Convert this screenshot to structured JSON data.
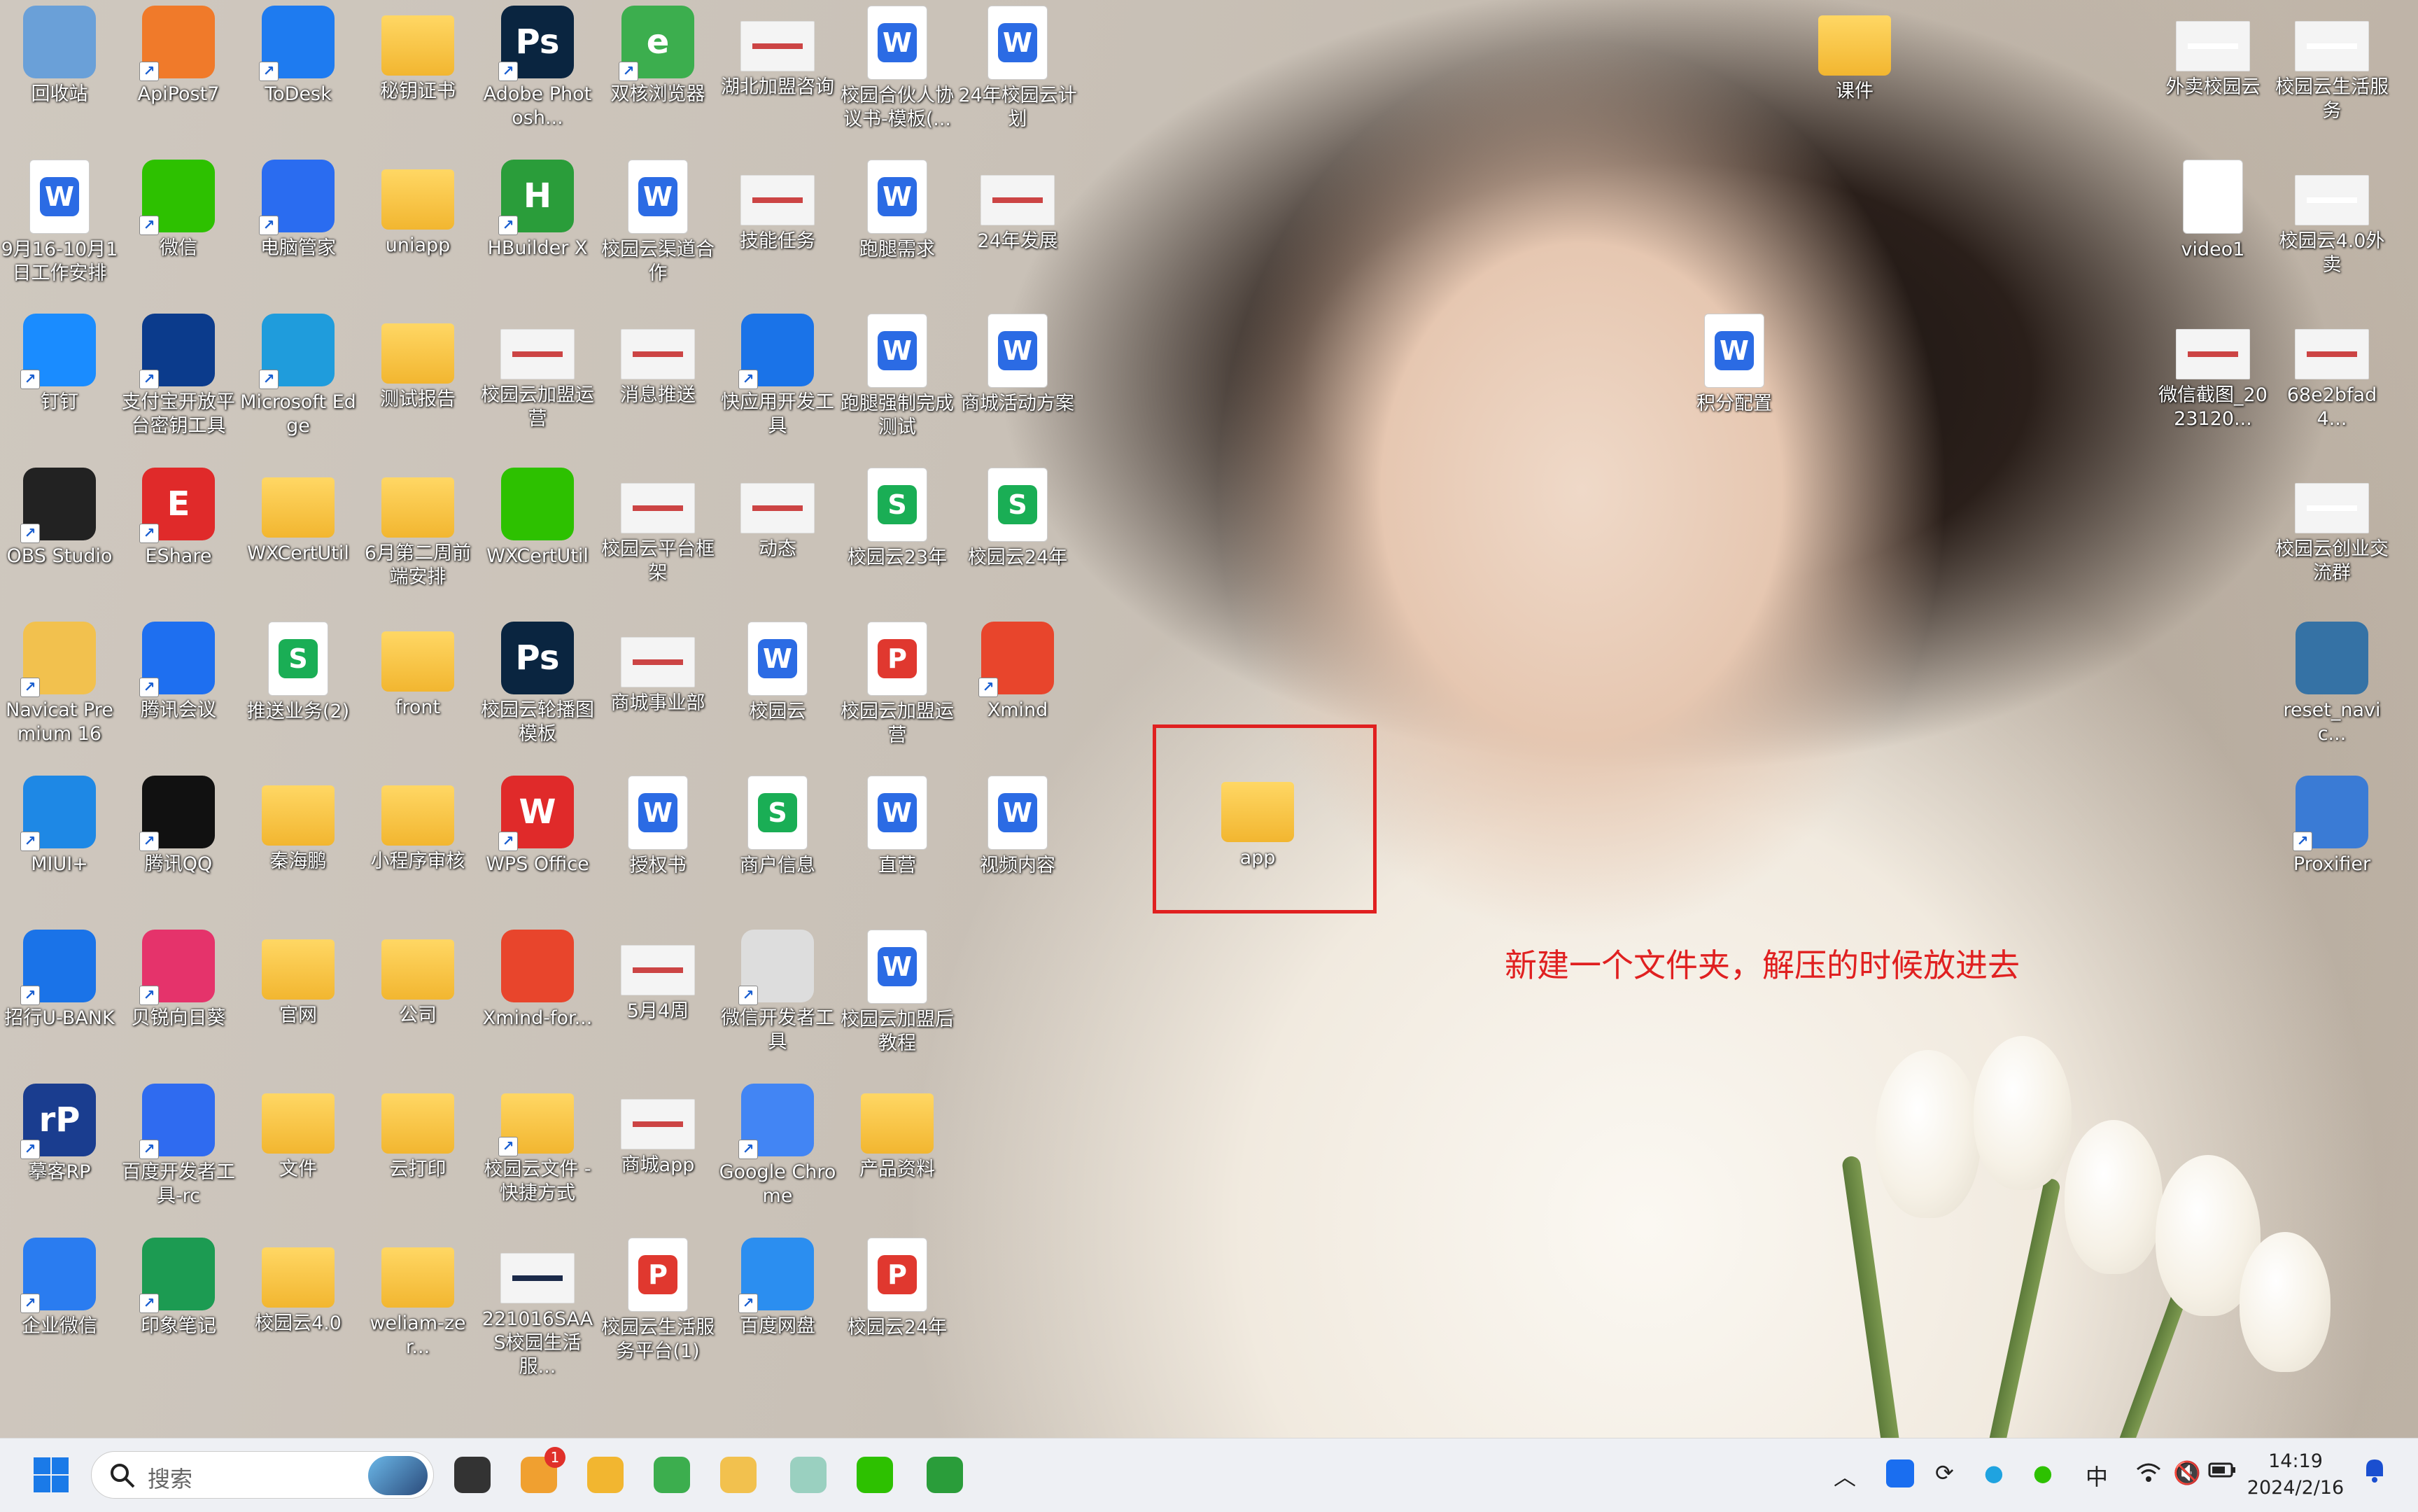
{
  "desktop_icons": [
    {
      "label": "回收站",
      "icon": "recycle-bin-icon",
      "color": "#6aa0d8",
      "type": "app",
      "shortcut": false
    },
    {
      "label": "ApiPost7",
      "icon": "apipost-icon",
      "color": "#f07a2a",
      "type": "app",
      "shortcut": true
    },
    {
      "label": "ToDesk",
      "icon": "todesk-icon",
      "color": "#1e7bf0",
      "type": "app",
      "shortcut": true
    },
    {
      "label": "秘钥证书",
      "icon": "folder-icon",
      "color": "#f5c141",
      "type": "folder",
      "shortcut": false
    },
    {
      "label": "Adobe Photosh...",
      "icon": "photoshop-icon",
      "color": "#0a2540",
      "type": "app",
      "shortcut": true,
      "glyph": "Ps"
    },
    {
      "label": "双核浏览器",
      "icon": "browser-icon",
      "color": "#3cae4e",
      "type": "app",
      "shortcut": true,
      "glyph": "e"
    },
    {
      "label": "湖北加盟咨询",
      "icon": "image-thumb-icon",
      "color": "#eeeeee",
      "type": "thumb",
      "shortcut": false
    },
    {
      "label": "校园合伙人协议书-模板(...",
      "icon": "word-doc-icon",
      "color": "#2b6be4",
      "type": "doc",
      "shortcut": false,
      "glyph": "W"
    },
    {
      "label": "24年校园云计划",
      "icon": "word-doc-icon",
      "color": "#2b6be4",
      "type": "doc",
      "shortcut": false,
      "glyph": "W"
    },
    {
      "label": "9月16-10月1日工作安排",
      "icon": "word-doc-icon",
      "color": "#2b6be4",
      "type": "doc",
      "shortcut": false,
      "glyph": "W"
    },
    {
      "label": "微信",
      "icon": "wechat-icon",
      "color": "#2dc100",
      "type": "app",
      "shortcut": true
    },
    {
      "label": "电脑管家",
      "icon": "pc-manager-icon",
      "color": "#2a6cf0",
      "type": "app",
      "shortcut": true
    },
    {
      "label": "uniapp",
      "icon": "folder-icon",
      "color": "#f5c141",
      "type": "folder",
      "shortcut": false
    },
    {
      "label": "HBuilder X",
      "icon": "hbuilder-icon",
      "color": "#2a9d3a",
      "type": "app",
      "shortcut": true,
      "glyph": "H"
    },
    {
      "label": "校园云渠道合作",
      "icon": "word-doc-icon",
      "color": "#2b6be4",
      "type": "doc",
      "shortcut": false,
      "glyph": "W"
    },
    {
      "label": "技能任务",
      "icon": "image-thumb-icon",
      "color": "#eeeeee",
      "type": "thumb",
      "shortcut": false
    },
    {
      "label": "跑腿需求",
      "icon": "word-doc-icon",
      "color": "#2b6be4",
      "type": "doc",
      "shortcut": false,
      "glyph": "W"
    },
    {
      "label": "24年发展",
      "icon": "image-thumb-icon",
      "color": "#eeeeee",
      "type": "thumb",
      "shortcut": false
    },
    {
      "label": "钉钉",
      "icon": "dingtalk-icon",
      "color": "#1a8cff",
      "type": "app",
      "shortcut": true
    },
    {
      "label": "支付宝开放平台密钥工具",
      "icon": "alipay-key-icon",
      "color": "#0b3b8c",
      "type": "app",
      "shortcut": true
    },
    {
      "label": "Microsoft Edge",
      "icon": "edge-icon",
      "color": "#1f9cdc",
      "type": "app",
      "shortcut": true
    },
    {
      "label": "测试报告",
      "icon": "folder-icon",
      "color": "#f5c141",
      "type": "folder",
      "shortcut": false
    },
    {
      "label": "校园云加盟运营",
      "icon": "image-thumb-icon",
      "color": "#eeeeee",
      "type": "thumb",
      "shortcut": false
    },
    {
      "label": "消息推送",
      "icon": "image-thumb-icon",
      "color": "#eeeeee",
      "type": "thumb",
      "shortcut": false
    },
    {
      "label": "快应用开发工具",
      "icon": "quickapp-icon",
      "color": "#1a73e8",
      "type": "app",
      "shortcut": true
    },
    {
      "label": "跑腿强制完成测试",
      "icon": "word-doc-icon",
      "color": "#2b6be4",
      "type": "doc",
      "shortcut": false,
      "glyph": "W"
    },
    {
      "label": "商城活动方案",
      "icon": "word-doc-icon",
      "color": "#2b6be4",
      "type": "doc",
      "shortcut": false,
      "glyph": "W"
    },
    {
      "label": "OBS Studio",
      "icon": "obs-icon",
      "color": "#222222",
      "type": "app",
      "shortcut": true
    },
    {
      "label": "EShare",
      "icon": "eshare-icon",
      "color": "#e02a2a",
      "type": "app",
      "shortcut": true,
      "glyph": "E"
    },
    {
      "label": "WXCertUtil",
      "icon": "folder-icon",
      "color": "#f5c141",
      "type": "folder",
      "shortcut": false
    },
    {
      "label": "6月第二周前端安排",
      "icon": "folder-icon",
      "color": "#f5c141",
      "type": "folder",
      "shortcut": false
    },
    {
      "label": "WXCertUtil",
      "icon": "wx-cert-icon",
      "color": "#2dc100",
      "type": "app",
      "shortcut": false
    },
    {
      "label": "校园云平台框架",
      "icon": "image-thumb-icon",
      "color": "#eeeeee",
      "type": "thumb",
      "shortcut": false
    },
    {
      "label": "动态",
      "icon": "image-thumb-icon",
      "color": "#eeeeee",
      "type": "thumb",
      "shortcut": false
    },
    {
      "label": "校园云23年",
      "icon": "sheet-doc-icon",
      "color": "#1aae55",
      "type": "doc",
      "shortcut": false,
      "glyph": "S"
    },
    {
      "label": "校园云24年",
      "icon": "sheet-doc-icon",
      "color": "#1aae55",
      "type": "doc",
      "shortcut": false,
      "glyph": "S"
    },
    {
      "label": "Navicat Premium 16",
      "icon": "navicat-icon",
      "color": "#f2c14e",
      "type": "app",
      "shortcut": true
    },
    {
      "label": "腾讯会议",
      "icon": "tencent-meeting-icon",
      "color": "#1e6ff0",
      "type": "app",
      "shortcut": true
    },
    {
      "label": "推送业务(2)",
      "icon": "sheet-doc-icon",
      "color": "#1aae55",
      "type": "doc",
      "shortcut": false,
      "glyph": "S"
    },
    {
      "label": "front",
      "icon": "folder-icon",
      "color": "#f5c141",
      "type": "folder",
      "shortcut": false
    },
    {
      "label": "校园云轮播图模板",
      "icon": "psd-icon",
      "color": "#0a2540",
      "type": "app",
      "shortcut": false,
      "glyph": "Ps"
    },
    {
      "label": "商城事业部",
      "icon": "image-thumb-icon",
      "color": "#eeeeee",
      "type": "thumb",
      "shortcut": false
    },
    {
      "label": "校园云",
      "icon": "word-doc-icon",
      "color": "#2b6be4",
      "type": "doc",
      "shortcut": false,
      "glyph": "W"
    },
    {
      "label": "校园云加盟运营",
      "icon": "pdf-doc-icon",
      "color": "#e0382f",
      "type": "doc",
      "shortcut": false,
      "glyph": "P"
    },
    {
      "label": "Xmind",
      "icon": "xmind-icon",
      "color": "#e8452c",
      "type": "app",
      "shortcut": true
    },
    {
      "label": "MIUI+",
      "icon": "miui-icon",
      "color": "#1e88e5",
      "type": "app",
      "shortcut": true
    },
    {
      "label": "腾讯QQ",
      "icon": "qq-icon",
      "color": "#111111",
      "type": "app",
      "shortcut": true
    },
    {
      "label": "秦海鹏",
      "icon": "folder-icon",
      "color": "#f5c141",
      "type": "folder",
      "shortcut": false
    },
    {
      "label": "小程序审核",
      "icon": "folder-icon",
      "color": "#f5c141",
      "type": "folder",
      "shortcut": false
    },
    {
      "label": "WPS Office",
      "icon": "wps-icon",
      "color": "#e02a2a",
      "type": "app",
      "shortcut": true,
      "glyph": "W"
    },
    {
      "label": "授权书",
      "icon": "word-doc-icon",
      "color": "#2b6be4",
      "type": "doc",
      "shortcut": false,
      "glyph": "W"
    },
    {
      "label": "商户信息",
      "icon": "sheet-doc-icon",
      "color": "#1aae55",
      "type": "doc",
      "shortcut": false,
      "glyph": "S"
    },
    {
      "label": "直营",
      "icon": "word-doc-icon",
      "color": "#2b6be4",
      "type": "doc",
      "shortcut": false,
      "glyph": "W"
    },
    {
      "label": "视频内容",
      "icon": "word-doc-icon",
      "color": "#2b6be4",
      "type": "doc",
      "shortcut": false,
      "glyph": "W"
    },
    {
      "label": "招行U-BANK",
      "icon": "ubank-icon",
      "color": "#1a73e8",
      "type": "app",
      "shortcut": true
    },
    {
      "label": "贝锐向日葵",
      "icon": "sunflower-icon",
      "color": "#e5336b",
      "type": "app",
      "shortcut": true
    },
    {
      "label": "官网",
      "icon": "folder-icon",
      "color": "#f5c141",
      "type": "folder",
      "shortcut": false
    },
    {
      "label": "公司",
      "icon": "folder-icon",
      "color": "#f5c141",
      "type": "folder",
      "shortcut": false
    },
    {
      "label": "Xmind-for...",
      "icon": "xmind-icon",
      "color": "#e8452c",
      "type": "app",
      "shortcut": false
    },
    {
      "label": "5月4周",
      "icon": "image-thumb-icon",
      "color": "#eeeeee",
      "type": "thumb",
      "shortcut": false
    },
    {
      "label": "微信开发者工具",
      "icon": "wechat-devtools-icon",
      "color": "#dddddd",
      "type": "app",
      "shortcut": true
    },
    {
      "label": "校园云加盟后教程",
      "icon": "word-doc-icon",
      "color": "#2b6be4",
      "type": "doc",
      "shortcut": false,
      "glyph": "W"
    },
    {
      "label": "摹客RP",
      "icon": "mockplus-icon",
      "color": "#1a3d8f",
      "type": "app",
      "shortcut": true,
      "glyph": "rP"
    },
    {
      "label": "百度开发者工具-rc",
      "icon": "baidu-devtools-icon",
      "color": "#2f6bf0",
      "type": "app",
      "shortcut": true
    },
    {
      "label": "文件",
      "icon": "folder-icon",
      "color": "#f5c141",
      "type": "folder",
      "shortcut": false
    },
    {
      "label": "云打印",
      "icon": "folder-icon",
      "color": "#f5c141",
      "type": "folder",
      "shortcut": false
    },
    {
      "label": "校园云文件 - 快捷方式",
      "icon": "folder-icon",
      "color": "#f5c141",
      "type": "folder",
      "shortcut": true
    },
    {
      "label": "商城app",
      "icon": "image-thumb-icon",
      "color": "#eeeeee",
      "type": "thumb",
      "shortcut": false
    },
    {
      "label": "Google Chrome",
      "icon": "chrome-icon",
      "color": "#4285f4",
      "type": "app",
      "shortcut": true
    },
    {
      "label": "产品资料",
      "icon": "folder-icon",
      "color": "#f5c141",
      "type": "folder",
      "shortcut": false
    },
    {
      "label": "企业微信",
      "icon": "wecom-icon",
      "color": "#2a7cf0",
      "type": "app",
      "shortcut": true
    },
    {
      "label": "印象笔记",
      "icon": "evernote-icon",
      "color": "#1c9b52",
      "type": "app",
      "shortcut": true
    },
    {
      "label": "校园云4.0",
      "icon": "folder-icon",
      "color": "#f5c141",
      "type": "folder",
      "shortcut": false
    },
    {
      "label": "weliam-zer...",
      "icon": "folder-icon",
      "color": "#f5c141",
      "type": "folder",
      "shortcut": false
    },
    {
      "label": "221016SAAS校园生活服...",
      "icon": "image-thumb-icon",
      "color": "#1b2a4a",
      "type": "thumb",
      "shortcut": false
    },
    {
      "label": "校园云生活服务平台(1)",
      "icon": "pdf-doc-icon",
      "color": "#e0382f",
      "type": "doc",
      "shortcut": false,
      "glyph": "P"
    },
    {
      "label": "百度网盘",
      "icon": "baidu-netdisk-icon",
      "color": "#2b8ef0",
      "type": "app",
      "shortcut": true
    },
    {
      "label": "校园云24年",
      "icon": "pdf-doc-icon",
      "color": "#e0382f",
      "type": "doc",
      "shortcut": false,
      "glyph": "P"
    },
    {
      "label": "课件",
      "icon": "folder-icon",
      "color": "#f5c141",
      "type": "folder",
      "shortcut": false
    },
    {
      "label": "积分配置",
      "icon": "word-doc-icon",
      "color": "#2b6be4",
      "type": "doc",
      "shortcut": false,
      "glyph": "W"
    },
    {
      "label": "app",
      "icon": "folder-icon",
      "color": "#f5c141",
      "type": "folder",
      "shortcut": false
    },
    {
      "label": "外卖校园云",
      "icon": "qr-image-icon",
      "color": "#ffffff",
      "type": "thumb",
      "shortcut": false
    },
    {
      "label": "校园云生活服务",
      "icon": "qr-image-icon",
      "color": "#ffffff",
      "type": "thumb",
      "shortcut": false
    },
    {
      "label": "video1",
      "icon": "blank-file-icon",
      "color": "#ffffff",
      "type": "doc",
      "shortcut": false
    },
    {
      "label": "校园云4.0外卖",
      "icon": "qr-image-icon",
      "color": "#ffffff",
      "type": "thumb",
      "shortcut": false
    },
    {
      "label": "微信截图_2023120...",
      "icon": "image-thumb-icon",
      "color": "#eeeeee",
      "type": "thumb",
      "shortcut": false
    },
    {
      "label": "68e2bfad4...",
      "icon": "image-thumb-icon",
      "color": "#eeeeee",
      "type": "thumb",
      "shortcut": false
    },
    {
      "label": "校园云创业交流群",
      "icon": "qr-image-icon",
      "color": "#ffffff",
      "type": "thumb",
      "shortcut": false
    },
    {
      "label": "reset_navic...",
      "icon": "python-script-icon",
      "color": "#3572a5",
      "type": "app",
      "shortcut": false
    },
    {
      "label": "Proxifier",
      "icon": "proxifier-icon",
      "color": "#3a7bd5",
      "type": "app",
      "shortcut": true
    }
  ],
  "annotation": {
    "text": "新建一个文件夹，解压的时候放进去",
    "color": "#e02020"
  },
  "taskbar": {
    "search_placeholder": "搜索",
    "apps": [
      {
        "name": "task-view-icon",
        "badge": ""
      },
      {
        "name": "notification-app-icon",
        "badge": "1"
      },
      {
        "name": "file-explorer-icon",
        "badge": ""
      },
      {
        "name": "browser-icon",
        "badge": ""
      },
      {
        "name": "navicat-icon",
        "badge": ""
      },
      {
        "name": "wechat-devtools-icon",
        "badge": ""
      },
      {
        "name": "wechat-icon",
        "badge": ""
      },
      {
        "name": "hbuilder-icon",
        "badge": ""
      }
    ],
    "tray_ime": "中",
    "clock_time": "14:19",
    "clock_date": "2024/2/16"
  }
}
